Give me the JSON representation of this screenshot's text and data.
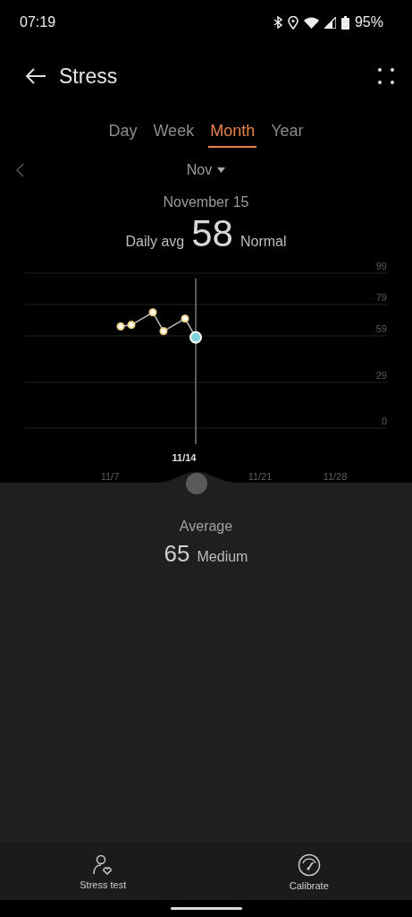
{
  "status_bar": {
    "time": "07:19",
    "battery": "95%"
  },
  "header": {
    "title": "Stress"
  },
  "tabs": [
    {
      "label": "Day",
      "selected": false
    },
    {
      "label": "Week",
      "selected": false
    },
    {
      "label": "Month",
      "selected": true
    },
    {
      "label": "Year",
      "selected": false
    }
  ],
  "period": {
    "label": "Nov"
  },
  "summary": {
    "date": "November 15",
    "prefix": "Daily avg",
    "value": "58",
    "level_label": "Normal"
  },
  "chart_data": {
    "type": "line",
    "categories": [
      null,
      null,
      null,
      null,
      null,
      null,
      "11/7",
      null,
      null,
      null,
      null,
      null,
      null,
      null,
      null,
      null,
      null,
      null,
      null,
      null,
      "11/21",
      null,
      null,
      null,
      null,
      null,
      null,
      "11/28",
      null,
      null
    ],
    "grid": true,
    "series": [
      {
        "color": "#f0d68a",
        "marker": "circle",
        "values": [
          null,
          null,
          null,
          null,
          null,
          null,
          null,
          65,
          66,
          null,
          74,
          62,
          null,
          70,
          58,
          null,
          null,
          null,
          null,
          null,
          null,
          null,
          null,
          null,
          null,
          null,
          null,
          null,
          null,
          null
        ]
      }
    ],
    "ylim": [
      0,
      99
    ],
    "yticks": [
      0,
      29,
      59,
      79,
      99
    ]
  },
  "selection": {
    "label": "11/14"
  },
  "average": {
    "label": "Average",
    "value": "65",
    "level_label": "Medium"
  },
  "actions": [
    {
      "label": "Stress test",
      "kind": "person"
    },
    {
      "label": "Calibrate",
      "kind": "gauge"
    }
  ]
}
